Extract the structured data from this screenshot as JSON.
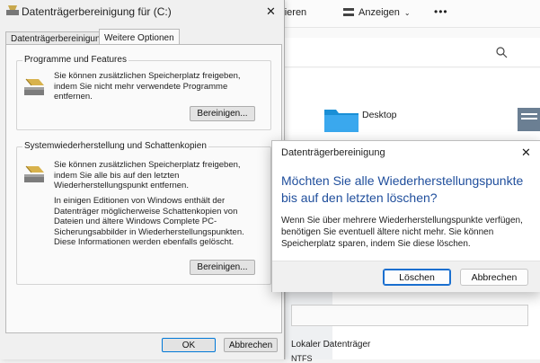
{
  "explorer": {
    "toolbar": {
      "sort_partial": "rtieren",
      "view": "Anzeigen",
      "more": "•••"
    },
    "folder_desktop": "Desktop",
    "drive_label": "Lokaler Datenträger",
    "fs_partial": "NTFS"
  },
  "cleanup_dialog": {
    "title": "Datenträgerbereinigung für  (C:)",
    "close": "✕",
    "tabs": [
      "Datenträgerbereinigung",
      "Weitere Optionen"
    ],
    "programs_group": {
      "label": "Programme und Features",
      "text": "Sie können zusätzlichen Speicherplatz freigeben, indem Sie nicht mehr verwendete Programme entfernen.",
      "button": "Bereinigen..."
    },
    "restore_group": {
      "label": "Systemwiederherstellung und Schattenkopien",
      "text1": "Sie können zusätzlichen Speicherplatz freigeben, indem Sie alle bis auf den letzten Wiederherstellungspunkt entfernen.",
      "text2": "In einigen Editionen von Windows enthält der Datenträger möglicherweise Schattenkopien von Dateien und ältere Windows Complete PC-Sicherungsabbilder in Wiederherstellungspunkten. Diese Informationen werden ebenfalls gelöscht.",
      "button": "Bereinigen..."
    },
    "ok": "OK",
    "cancel": "Abbrechen"
  },
  "confirm_dialog": {
    "title": "Datenträgerbereinigung",
    "close": "✕",
    "heading": "Möchten Sie alle Wiederherstellungspunkte bis auf den letzten löschen?",
    "body": "Wenn Sie über mehrere Wiederherstellungspunkte verfügen, benötigen Sie eventuell ältere nicht mehr. Sie können Speicherplatz sparen, indem Sie diese löschen.",
    "delete": "Löschen",
    "cancel": "Abbrechen"
  },
  "colors": {
    "accent": "#0078d7",
    "heading": "#1f4e9c",
    "folder": "#1a8fd6"
  }
}
